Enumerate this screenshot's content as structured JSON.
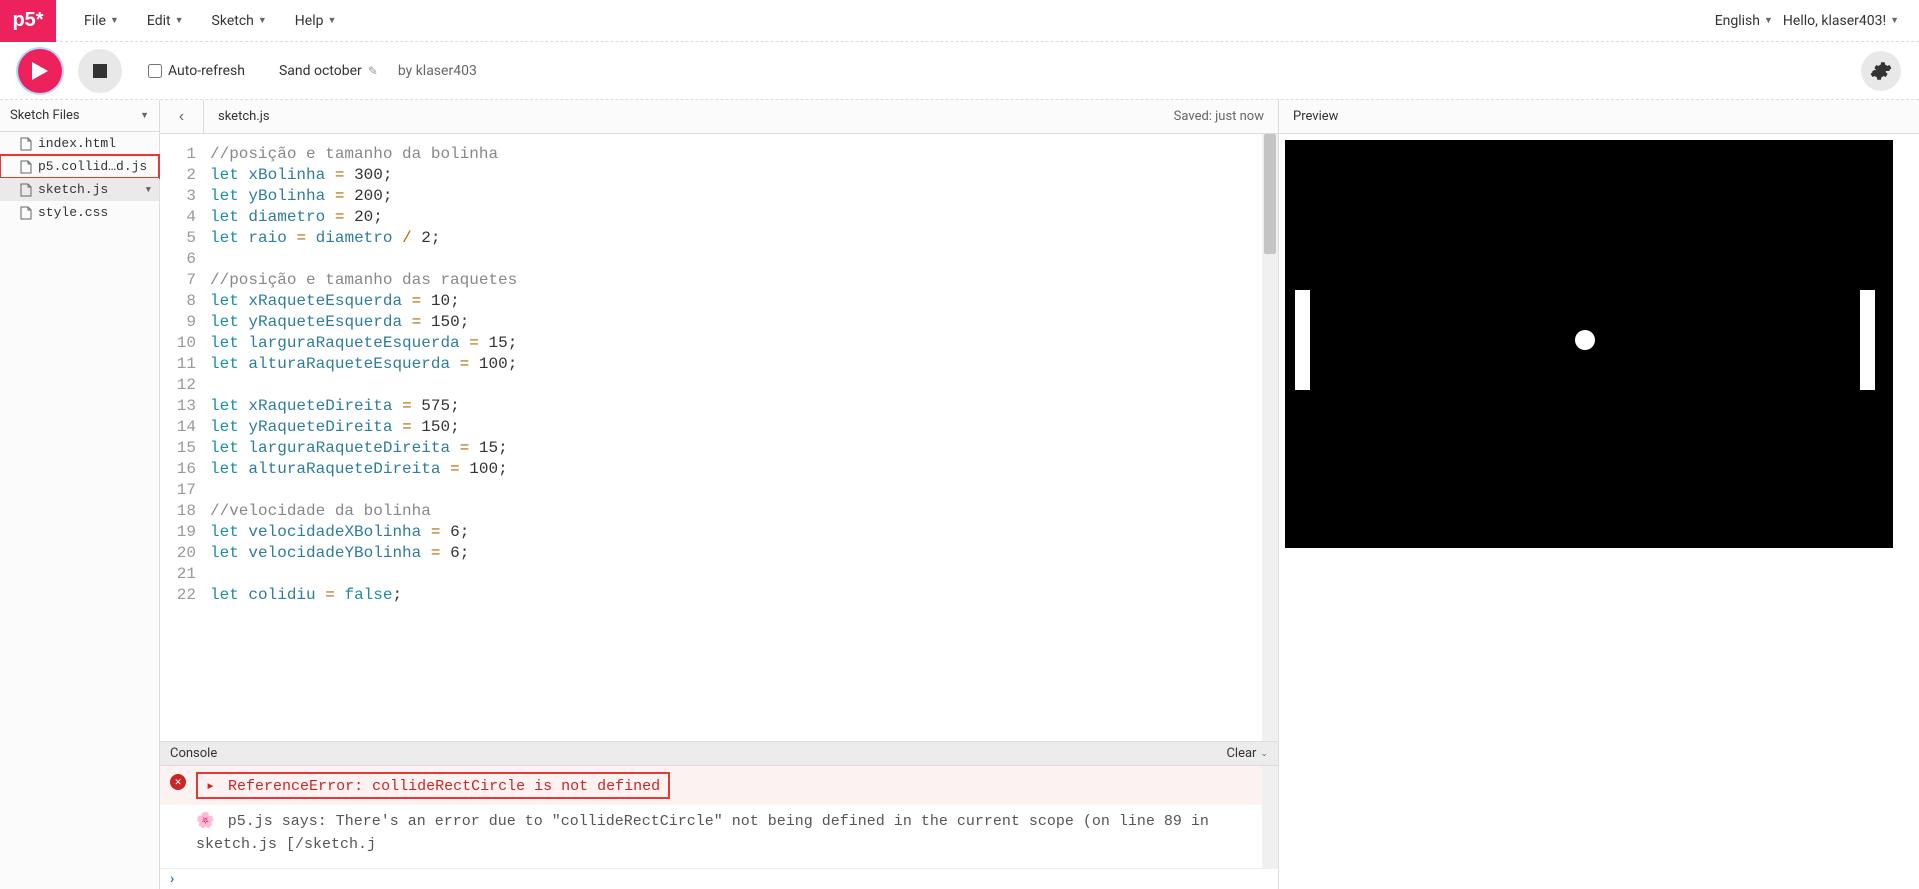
{
  "brand": "p5*",
  "menu": {
    "file": "File",
    "edit": "Edit",
    "sketch": "Sketch",
    "help": "Help"
  },
  "topright": {
    "language": "English",
    "greeting": "Hello, klaser403!"
  },
  "toolbar": {
    "autorefresh_label": "Auto-refresh",
    "sketch_name": "Sand october",
    "byline": "by klaser403"
  },
  "sidebar": {
    "title": "Sketch Files",
    "files": [
      {
        "name": "index.html"
      },
      {
        "name": "p5.collid…d.js"
      },
      {
        "name": "sketch.js"
      },
      {
        "name": "style.css"
      }
    ]
  },
  "editor": {
    "current_file": "sketch.js",
    "saved_status": "Saved: just now",
    "lines": [
      [
        [
          "comment",
          "//posição e tamanho da bolinha"
        ]
      ],
      [
        [
          "keyword",
          "let"
        ],
        [
          "sp",
          " "
        ],
        [
          "var",
          "xBolinha"
        ],
        [
          "sp",
          " "
        ],
        [
          "op",
          "="
        ],
        [
          "sp",
          " "
        ],
        [
          "num",
          "300"
        ],
        [
          "plain",
          ";"
        ]
      ],
      [
        [
          "keyword",
          "let"
        ],
        [
          "sp",
          " "
        ],
        [
          "var",
          "yBolinha"
        ],
        [
          "sp",
          " "
        ],
        [
          "op",
          "="
        ],
        [
          "sp",
          " "
        ],
        [
          "num",
          "200"
        ],
        [
          "plain",
          ";"
        ]
      ],
      [
        [
          "keyword",
          "let"
        ],
        [
          "sp",
          " "
        ],
        [
          "var",
          "diametro"
        ],
        [
          "sp",
          " "
        ],
        [
          "op",
          "="
        ],
        [
          "sp",
          " "
        ],
        [
          "num",
          "20"
        ],
        [
          "plain",
          ";"
        ]
      ],
      [
        [
          "keyword",
          "let"
        ],
        [
          "sp",
          " "
        ],
        [
          "var",
          "raio"
        ],
        [
          "sp",
          " "
        ],
        [
          "op",
          "="
        ],
        [
          "sp",
          " "
        ],
        [
          "var",
          "diametro"
        ],
        [
          "sp",
          " "
        ],
        [
          "op",
          "/"
        ],
        [
          "sp",
          " "
        ],
        [
          "num",
          "2"
        ],
        [
          "plain",
          ";"
        ]
      ],
      [],
      [
        [
          "comment",
          "//posição e tamanho das raquetes"
        ]
      ],
      [
        [
          "keyword",
          "let"
        ],
        [
          "sp",
          " "
        ],
        [
          "var",
          "xRaqueteEsquerda"
        ],
        [
          "sp",
          " "
        ],
        [
          "op",
          "="
        ],
        [
          "sp",
          " "
        ],
        [
          "num",
          "10"
        ],
        [
          "plain",
          ";"
        ]
      ],
      [
        [
          "keyword",
          "let"
        ],
        [
          "sp",
          " "
        ],
        [
          "var",
          "yRaqueteEsquerda"
        ],
        [
          "sp",
          " "
        ],
        [
          "op",
          "="
        ],
        [
          "sp",
          " "
        ],
        [
          "num",
          "150"
        ],
        [
          "plain",
          ";"
        ]
      ],
      [
        [
          "keyword",
          "let"
        ],
        [
          "sp",
          " "
        ],
        [
          "var",
          "larguraRaqueteEsquerda"
        ],
        [
          "sp",
          " "
        ],
        [
          "op",
          "="
        ],
        [
          "sp",
          " "
        ],
        [
          "num",
          "15"
        ],
        [
          "plain",
          ";"
        ]
      ],
      [
        [
          "keyword",
          "let"
        ],
        [
          "sp",
          " "
        ],
        [
          "var",
          "alturaRaqueteEsquerda"
        ],
        [
          "sp",
          " "
        ],
        [
          "op",
          "="
        ],
        [
          "sp",
          " "
        ],
        [
          "num",
          "100"
        ],
        [
          "plain",
          ";"
        ]
      ],
      [],
      [
        [
          "keyword",
          "let"
        ],
        [
          "sp",
          " "
        ],
        [
          "var",
          "xRaqueteDireita"
        ],
        [
          "sp",
          " "
        ],
        [
          "op",
          "="
        ],
        [
          "sp",
          " "
        ],
        [
          "num",
          "575"
        ],
        [
          "plain",
          ";"
        ]
      ],
      [
        [
          "keyword",
          "let"
        ],
        [
          "sp",
          " "
        ],
        [
          "var",
          "yRaqueteDireita"
        ],
        [
          "sp",
          " "
        ],
        [
          "op",
          "="
        ],
        [
          "sp",
          " "
        ],
        [
          "num",
          "150"
        ],
        [
          "plain",
          ";"
        ]
      ],
      [
        [
          "keyword",
          "let"
        ],
        [
          "sp",
          " "
        ],
        [
          "var",
          "larguraRaqueteDireita"
        ],
        [
          "sp",
          " "
        ],
        [
          "op",
          "="
        ],
        [
          "sp",
          " "
        ],
        [
          "num",
          "15"
        ],
        [
          "plain",
          ";"
        ]
      ],
      [
        [
          "keyword",
          "let"
        ],
        [
          "sp",
          " "
        ],
        [
          "var",
          "alturaRaqueteDireita"
        ],
        [
          "sp",
          " "
        ],
        [
          "op",
          "="
        ],
        [
          "sp",
          " "
        ],
        [
          "num",
          "100"
        ],
        [
          "plain",
          ";"
        ]
      ],
      [],
      [
        [
          "comment",
          "//velocidade da bolinha"
        ]
      ],
      [
        [
          "keyword",
          "let"
        ],
        [
          "sp",
          " "
        ],
        [
          "var",
          "velocidadeXBolinha"
        ],
        [
          "sp",
          " "
        ],
        [
          "op",
          "="
        ],
        [
          "sp",
          " "
        ],
        [
          "num",
          "6"
        ],
        [
          "plain",
          ";"
        ]
      ],
      [
        [
          "keyword",
          "let"
        ],
        [
          "sp",
          " "
        ],
        [
          "var",
          "velocidadeYBolinha"
        ],
        [
          "sp",
          " "
        ],
        [
          "op",
          "="
        ],
        [
          "sp",
          " "
        ],
        [
          "num",
          "6"
        ],
        [
          "plain",
          ";"
        ]
      ],
      [],
      [
        [
          "keyword",
          "let"
        ],
        [
          "sp",
          " "
        ],
        [
          "var",
          "colidiu"
        ],
        [
          "sp",
          " "
        ],
        [
          "op",
          "="
        ],
        [
          "sp",
          " "
        ],
        [
          "keyword",
          "false"
        ],
        [
          "plain",
          ";"
        ]
      ]
    ]
  },
  "console": {
    "title": "Console",
    "clear": "Clear",
    "error_text": "ReferenceError: collideRectCircle is not defined",
    "info_text": "p5.js says: There's an error due to \"collideRectCircle\" not being defined in the current scope (on line 89 in sketch.js [/sketch.j"
  },
  "preview": {
    "title": "Preview"
  }
}
